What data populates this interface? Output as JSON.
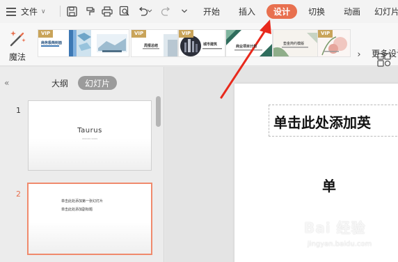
{
  "menubar": {
    "file_label": "文件",
    "tabs": [
      {
        "label": "开始",
        "active": false
      },
      {
        "label": "插入",
        "active": false
      },
      {
        "label": "设计",
        "active": true
      },
      {
        "label": "切换",
        "active": false
      },
      {
        "label": "动画",
        "active": false
      },
      {
        "label": "幻灯片",
        "active": false
      }
    ],
    "accent_color": "#e8704f"
  },
  "ribbon": {
    "magic_label": "魔法",
    "more_label": "更多设计",
    "templates": [
      {
        "vip": "VIP",
        "title": "商务极简封面"
      },
      {
        "vip": "",
        "title": ""
      },
      {
        "vip": "VIP",
        "title": "周报总结"
      },
      {
        "vip": "VIP",
        "title": "城市建筑"
      },
      {
        "vip": "",
        "title": "商业项目计划"
      },
      {
        "vip": "",
        "title": "垫金简约模版"
      },
      {
        "vip": "VIP",
        "title": ""
      }
    ]
  },
  "left_panel": {
    "outline_label": "大纲",
    "slides_label": "幻灯片",
    "slides": [
      {
        "number": "1",
        "title": "Taurus",
        "subtitle": "xxxxxxx xxxxx"
      },
      {
        "number": "2",
        "line1": "单击此处添加第一张幻灯片",
        "line2": "单击此处添加副标题"
      }
    ]
  },
  "canvas": {
    "title_placeholder": "单击此处添加英",
    "subtitle_placeholder": "单"
  },
  "watermark": {
    "brand": "Bai 经验",
    "url": "jingyan.baidu.com"
  }
}
